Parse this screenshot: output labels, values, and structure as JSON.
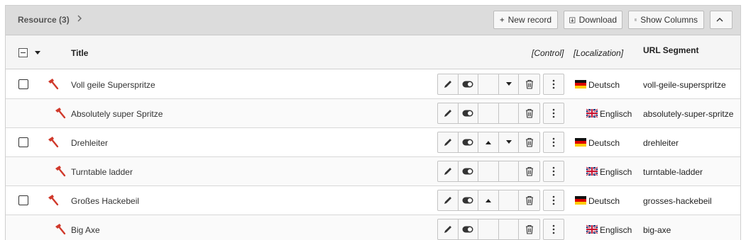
{
  "header": {
    "title": "Resource",
    "count": "(3)",
    "new_record": "New record",
    "download": "Download",
    "show_columns": "Show Columns"
  },
  "columns": {
    "title": "Title",
    "control": "[Control]",
    "localization": "[Localization]",
    "url_segment": "URL Segment"
  },
  "rows": [
    {
      "title": "Voll geile Superspritze",
      "language": "Deutsch",
      "url": "voll-geile-superspritze",
      "type": "parent",
      "up": false,
      "down": true
    },
    {
      "title": "Absolutely super Spritze",
      "language": "Englisch",
      "url": "absolutely-super-spritze",
      "type": "translation",
      "up": false,
      "down": false
    },
    {
      "title": "Drehleiter",
      "language": "Deutsch",
      "url": "drehleiter",
      "type": "parent",
      "up": true,
      "down": true
    },
    {
      "title": "Turntable ladder",
      "language": "Englisch",
      "url": "turntable-ladder",
      "type": "translation",
      "up": false,
      "down": false
    },
    {
      "title": "Großes Hackebeil",
      "language": "Deutsch",
      "url": "grosses-hackebeil",
      "type": "parent",
      "up": true,
      "down": false
    },
    {
      "title": "Big Axe",
      "language": "Englisch",
      "url": "big-axe",
      "type": "translation",
      "up": false,
      "down": false
    }
  ],
  "icons": {
    "record": "axe-icon",
    "edit": "pencil-icon",
    "toggle": "toggle-icon",
    "delete": "trash-icon",
    "more": "more-vertical-icon",
    "up": "caret-up-icon",
    "down": "caret-down-icon"
  },
  "colors": {
    "record_icon": "#d0392b",
    "header_bg": "#dcdcdc"
  }
}
